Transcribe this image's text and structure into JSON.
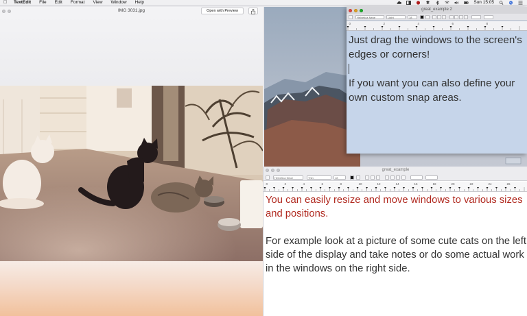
{
  "menubar": {
    "apple": "",
    "app_name": "TextEdit",
    "items": [
      "File",
      "Edit",
      "Format",
      "View",
      "Window",
      "Help"
    ],
    "clock": "Sun 15:05"
  },
  "preview": {
    "title": "IMG 3031.jpg",
    "open_button": "Open with Preview",
    "share_icon": "share-icon"
  },
  "textedit_top": {
    "title": "great_example 2",
    "font_name": "Helvetica Neue",
    "font_style": "Light",
    "font_size": "18",
    "paragraph_1": "Just drag the windows to the screen's edges or corners!",
    "paragraph_2": "If you want you can also define your own custom snap areas.",
    "ruler_labels": [
      "0",
      "2",
      "4",
      "6",
      "8"
    ],
    "background": "#c6d5ea"
  },
  "textedit_bottom": {
    "title": "great_example",
    "font_name": "Helvetica Neue",
    "font_style": "Thin",
    "font_size": "18",
    "paragraph_1": "You can easily resize and move windows to various sizes and positions.",
    "paragraph_2": "For example look at a picture of some cute cats on the left side of the display and take notes or do some actual work in the windows on the right side.",
    "ruler_labels": [
      "0",
      "2",
      "4",
      "6",
      "8",
      "10",
      "12",
      "14",
      "16",
      "18",
      "20",
      "22",
      "24",
      "26"
    ],
    "accent": "#b12a20"
  }
}
